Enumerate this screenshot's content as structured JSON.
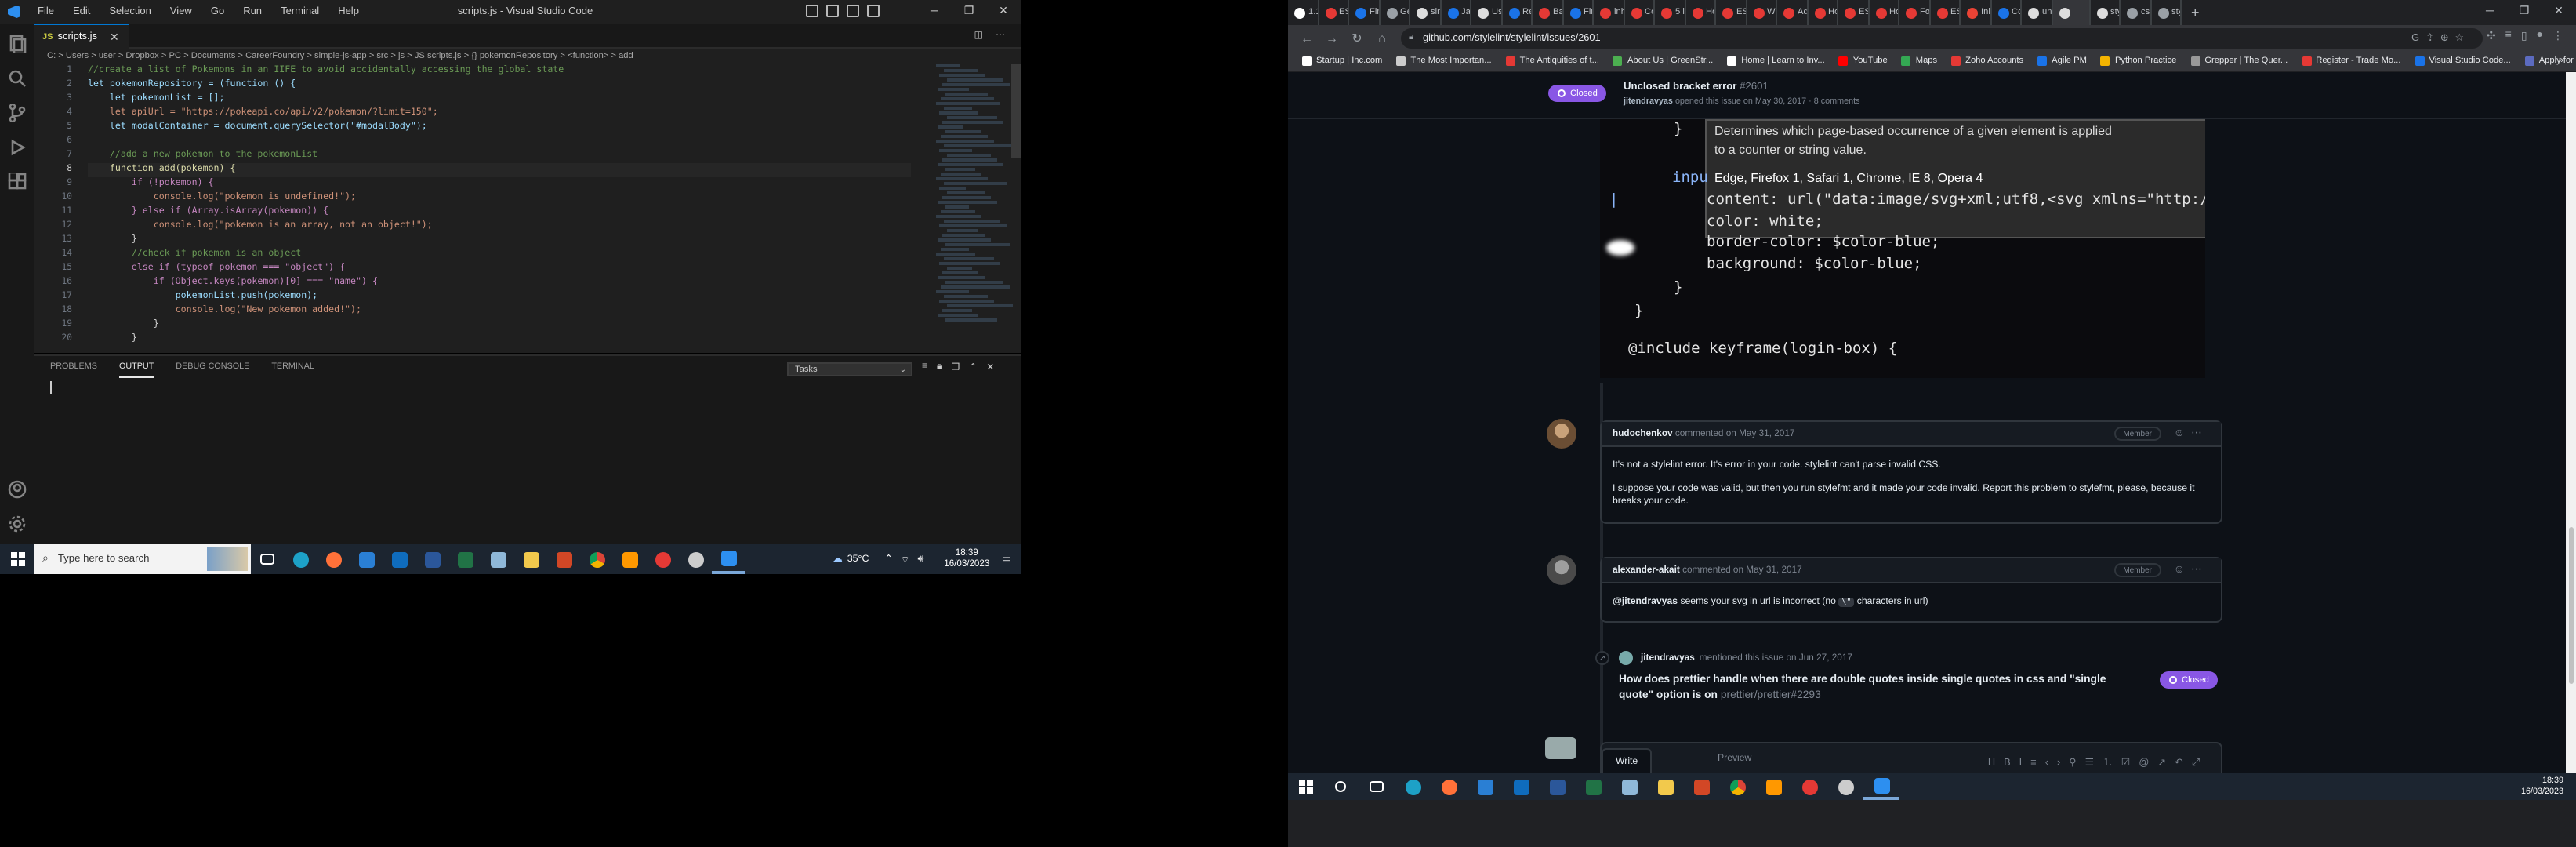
{
  "vscode": {
    "menu": [
      "File",
      "Edit",
      "Selection",
      "View",
      "Go",
      "Run",
      "Terminal",
      "Help"
    ],
    "window_title": "scripts.js - Visual Studio Code",
    "tab_label": "scripts.js",
    "breadcrumb": "C: > Users > user > Dropbox > PC > Documents > CareerFoundry > simple-js-app > src > js > JS scripts.js > {} pokemonRepository > <function> > add",
    "line_numbers": [
      "1",
      "2",
      "3",
      "4",
      "5",
      "6",
      "7",
      "8",
      "9",
      "10",
      "11",
      "12",
      "13",
      "14",
      "15",
      "16",
      "17",
      "18",
      "19",
      "20"
    ],
    "code_lines": [
      {
        "t": "//create a list of Pokemons in an IIFE to avoid accidentally accessing the global state",
        "c": "#6a9955"
      },
      {
        "t": "let pokemonRepository = (function () {",
        "c": "#9cdcfe"
      },
      {
        "t": "    let pokemonList = [];",
        "c": "#9cdcfe"
      },
      {
        "t": "    let apiUrl = \"https://pokeapi.co/api/v2/pokemon/?limit=150\";",
        "c": "#ce9178"
      },
      {
        "t": "    let modalContainer = document.querySelector(\"#modalBody\");",
        "c": "#9cdcfe"
      },
      {
        "t": "",
        "c": "#d4d4d4"
      },
      {
        "t": "    //add a new pokemon to the pokemonList",
        "c": "#6a9955"
      },
      {
        "t": "    function add(pokemon) {",
        "c": "#dcdcaa"
      },
      {
        "t": "        if (!pokemon) {",
        "c": "#c586c0"
      },
      {
        "t": "            console.log(\"pokemon is undefined!\");",
        "c": "#ce9178"
      },
      {
        "t": "        } else if (Array.isArray(pokemon)) {",
        "c": "#c586c0"
      },
      {
        "t": "            console.log(\"pokemon is an array, not an object!\");",
        "c": "#ce9178"
      },
      {
        "t": "        }",
        "c": "#d4d4d4"
      },
      {
        "t": "        //check if pokemon is an object",
        "c": "#6a9955"
      },
      {
        "t": "        else if (typeof pokemon === \"object\") {",
        "c": "#c586c0"
      },
      {
        "t": "            if (Object.keys(pokemon)[0] === \"name\") {",
        "c": "#c586c0"
      },
      {
        "t": "                pokemonList.push(pokemon);",
        "c": "#9cdcfe"
      },
      {
        "t": "                console.log(\"New pokemon added!\");",
        "c": "#ce9178"
      },
      {
        "t": "            }",
        "c": "#d4d4d4"
      },
      {
        "t": "        }",
        "c": "#d4d4d4"
      }
    ],
    "panel_tabs": [
      "PROBLEMS",
      "OUTPUT",
      "DEBUG CONSOLE",
      "TERMINAL"
    ],
    "panel_select": "Tasks"
  },
  "taskbar_left": {
    "search_placeholder": "Type here to search",
    "weather": "35°C",
    "time": "18:39",
    "date": "16/03/2023"
  },
  "chrome": {
    "tabs": [
      "1.1",
      "ES",
      "Fin",
      "Ge",
      "sim",
      "Ja",
      "Us",
      "Re",
      "Bal",
      "Fin",
      "inh",
      "Co",
      "5 li",
      "Ho",
      "ES",
      "Wh",
      "Ad",
      "Ho",
      "ES",
      "Ho",
      "Fo",
      "ES",
      "Inl",
      "Co",
      "un",
      "",
      "sty",
      "css",
      "sty"
    ],
    "url": "github.com/stylelint/stylelint/issues/2601",
    "bookmarks": [
      "Startup | Inc.com",
      "The Most Importan...",
      "The Antiquities of t...",
      "About Us | GreenStr...",
      "Home | Learn to Inv...",
      "YouTube",
      "Maps",
      "Zoho Accounts",
      "Agile PM",
      "Python Practice",
      "Grepper | The Quer...",
      "Register - Trade Mo...",
      "Visual Studio Code...",
      "Apply for a U.S. Vis..."
    ],
    "colors": {
      "closed_badge": "#8957e5",
      "page_bg": "#0d1117"
    }
  },
  "issue": {
    "status": "Closed",
    "title": "Unclosed bracket error",
    "number": "#2601",
    "opener": "jitendravyas",
    "opened_meta": "opened this issue on May 30, 2017 · 8 comments",
    "screenshot_lines": [
      "Determines which page-based occurrence of a given element is applied",
      "to a counter or string value.",
      "Edge, Firefox 1, Safari 1, Chrome, IE 8, Opera 4",
      "content: url(\"data:image/svg+xml;utf8,<svg xmlns=\"http:/",
      "color: white;",
      "border-color: $color-blue;",
      "background: $color-blue;",
      "@include keyframe(login-box) {"
    ],
    "comments": [
      {
        "author": "hudochenkov",
        "meta": "commented on May 31, 2017",
        "role": "Member",
        "paragraphs": [
          "It's not a stylelint error. It's error in your code. stylelint can't parse invalid CSS.",
          "I suppose your code was valid, but then you run stylefmt and it made your code invalid. Report this problem to stylefmt, please, because it breaks your code."
        ]
      },
      {
        "author": "alexander-akait",
        "meta": "commented on May 31, 2017",
        "role": "Member",
        "mention": "@jitendravyas",
        "text_before": "seems your svg in url is incorrect (no",
        "code": "\\\"",
        "text_after": "characters in url)"
      }
    ],
    "mention_event": {
      "user": "jitendravyas",
      "meta": "mentioned this issue on Jun 27, 2017",
      "title": "How does prettier handle when there are double quotes inside single quotes in css and \"single quote\" option is on",
      "ref": "prettier/prettier#2293",
      "status": "Closed"
    },
    "editor_tabs": [
      "Write",
      "Preview"
    ]
  },
  "taskbar_right": {
    "time": "18:39",
    "date": "16/03/2023"
  }
}
